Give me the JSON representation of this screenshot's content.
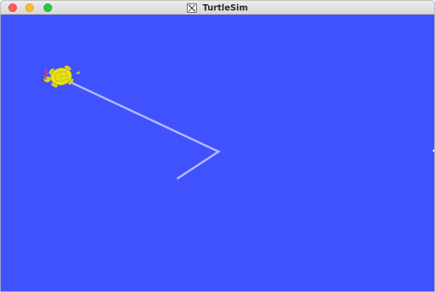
{
  "window": {
    "title": "TurtleSim",
    "app_icon": "x11-icon",
    "buttons": {
      "close": "close-button",
      "minimize": "minimize-button",
      "zoom": "zoom-button"
    }
  },
  "sim": {
    "background_color": "#4052fe",
    "pen_color": "#b3b8ff",
    "turtle": {
      "icon": "turtle-icon",
      "shell_color": "#e7e31a"
    }
  }
}
